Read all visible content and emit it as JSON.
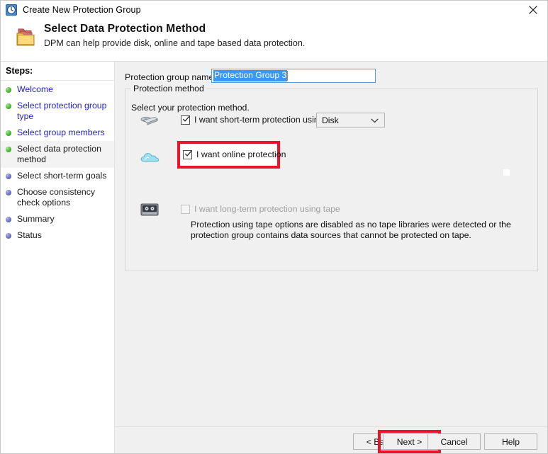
{
  "window": {
    "title": "Create New Protection Group",
    "title_icon": "clock-history-icon",
    "close_icon": "close-icon"
  },
  "header": {
    "icon": "folders-icon",
    "title": "Select Data Protection Method",
    "subtitle": "DPM can help provide disk, online and tape based data protection."
  },
  "sidebar": {
    "label": "Steps:",
    "items": [
      {
        "label": "Welcome",
        "state": "done",
        "link": true,
        "active": false
      },
      {
        "label": "Select protection group type",
        "state": "done",
        "link": true,
        "active": false
      },
      {
        "label": "Select group members",
        "state": "done",
        "link": true,
        "active": false
      },
      {
        "label": "Select data protection method",
        "state": "done",
        "link": false,
        "active": true
      },
      {
        "label": "Select short-term goals",
        "state": "todo",
        "link": false,
        "active": false
      },
      {
        "label": "Choose consistency check options",
        "state": "todo",
        "link": false,
        "active": false
      },
      {
        "label": "Summary",
        "state": "todo",
        "link": false,
        "active": false
      },
      {
        "label": "Status",
        "state": "todo",
        "link": false,
        "active": false
      }
    ]
  },
  "main": {
    "group_name_label": "Protection group name:",
    "group_name_value": "Protection Group 3",
    "groupbox_legend": "Protection method",
    "instruction": "Select your protection method.",
    "short_term": {
      "icon": "disk-icon",
      "checkbox_label": "I want short-term protection using:",
      "checked": true,
      "select_value": "Disk",
      "select_chevron": "chevron-down-icon"
    },
    "online": {
      "icon": "cloud-icon",
      "checkbox_label": "I want online protection",
      "checked": true,
      "highlighted": true
    },
    "long_term": {
      "icon": "tape-icon",
      "checkbox_label": "I want long-term protection using tape",
      "checked": false,
      "disabled": true,
      "note": "Protection using tape options are disabled as no tape libraries were detected or the protection group contains data sources that cannot be protected on tape."
    }
  },
  "footer": {
    "back_label": "< Back",
    "next_label": "Next >",
    "cancel_label": "Cancel",
    "help_label": "Help",
    "next_highlighted": true
  },
  "colors": {
    "highlight_red": "#e8152a",
    "link_blue": "#2222cc",
    "selection_blue": "#3399ff",
    "done_green": "#49b72e",
    "todo_purple": "#6d72c9",
    "pane_gray": "#f0f0f0"
  }
}
